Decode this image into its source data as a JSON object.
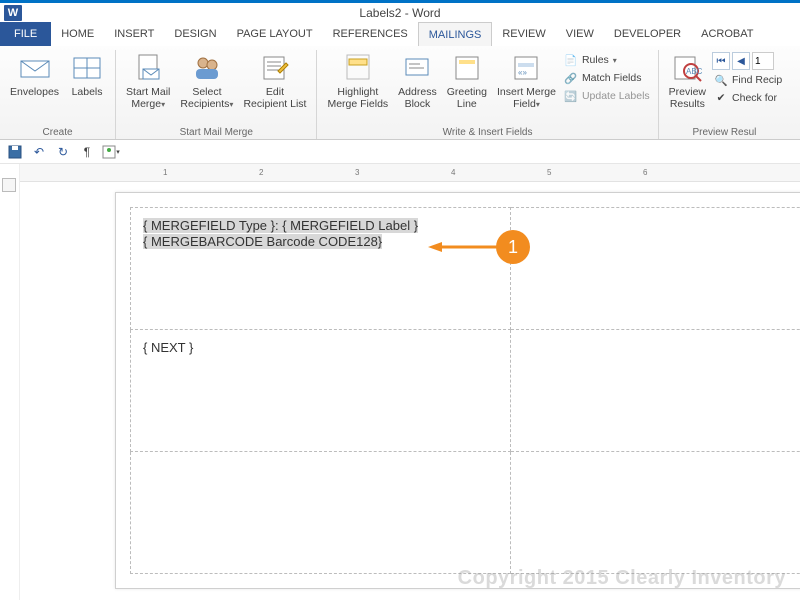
{
  "title": "Labels2 - Word",
  "tabs": {
    "file": "FILE",
    "home": "HOME",
    "insert": "INSERT",
    "design": "DESIGN",
    "pagelayout": "PAGE LAYOUT",
    "references": "REFERENCES",
    "mailings": "MAILINGS",
    "review": "REVIEW",
    "view": "VIEW",
    "developer": "DEVELOPER",
    "acrobat": "ACROBAT"
  },
  "ribbon": {
    "create": {
      "label": "Create",
      "envelopes": "Envelopes",
      "labels": "Labels"
    },
    "startmm": {
      "label": "Start Mail Merge",
      "start": "Start Mail\nMerge",
      "select": "Select\nRecipients",
      "edit": "Edit\nRecipient List"
    },
    "write": {
      "label": "Write & Insert Fields",
      "highlight": "Highlight\nMerge Fields",
      "address": "Address\nBlock",
      "greeting": "Greeting\nLine",
      "insert": "Insert Merge\nField",
      "rules": "Rules",
      "match": "Match Fields",
      "update": "Update Labels"
    },
    "preview": {
      "label": "Preview Resul",
      "preview": "Preview\nResults",
      "find": "Find Recip",
      "check": "Check for",
      "record": "1"
    }
  },
  "ruler_marks": [
    "1",
    "2",
    "3",
    "4",
    "5",
    "6"
  ],
  "doc": {
    "cell1_line1": "{ MERGEFIELD Type }:  { MERGEFIELD Label }",
    "cell1_line2": "{ MERGEBARCODE Barcode CODE128}",
    "cell2_line1": "{ NEXT }"
  },
  "callout": {
    "number": "1"
  },
  "watermark": "Copyright 2015 Clearly Inventory"
}
